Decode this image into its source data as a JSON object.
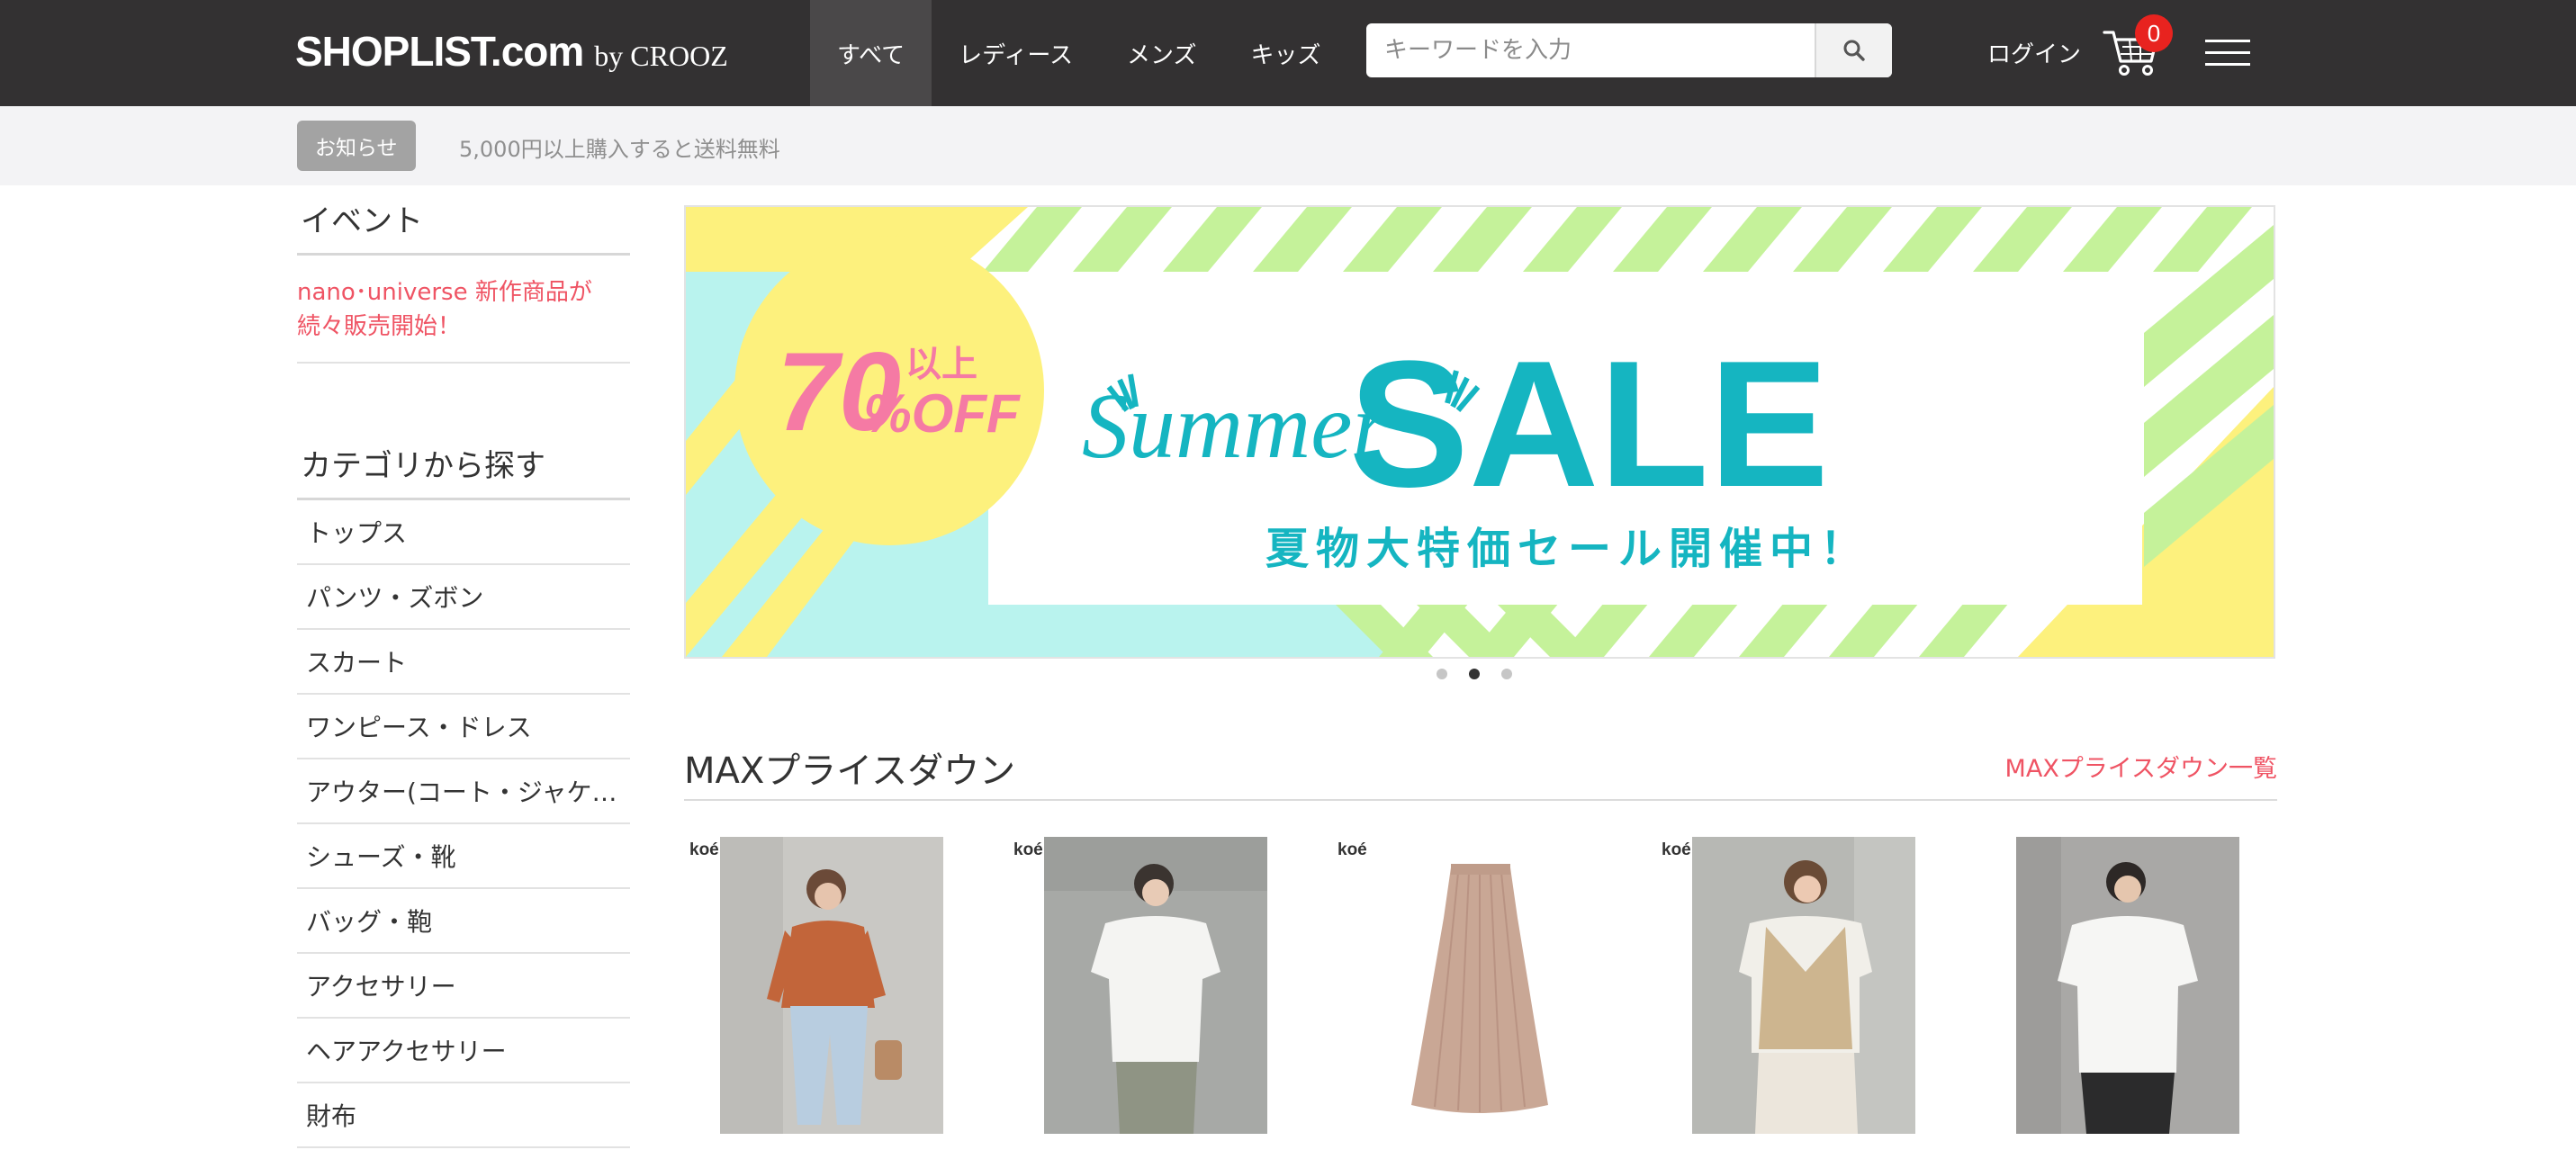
{
  "header": {
    "logo_main": "SHOPLIST.com",
    "logo_by": "by CROOZ",
    "nav": [
      {
        "label": "すべて",
        "active": true
      },
      {
        "label": "レディース",
        "active": false
      },
      {
        "label": "メンズ",
        "active": false
      },
      {
        "label": "キッズ",
        "active": false
      }
    ],
    "search_placeholder": "キーワードを入力",
    "search_icon": "search-icon",
    "login_label": "ログイン",
    "cart_count": "0",
    "cart_icon": "cart-icon",
    "menu_icon": "hamburger-menu-icon"
  },
  "notice": {
    "badge": "お知らせ",
    "text": "5,000円以上購入すると送料無料"
  },
  "sidebar": {
    "event_heading": "イベント",
    "event_link": "nano･universe 新作商品が続々販売開始！",
    "category_heading": "カテゴリから探す",
    "categories": [
      "トップス",
      "パンツ・ズボン",
      "スカート",
      "ワンピース・ドレス",
      "アウター(コート・ジャケ…",
      "シューズ・靴",
      "バッグ・鞄",
      "アクセサリー",
      "ヘアアクセサリー",
      "財布"
    ]
  },
  "banner": {
    "percent": "70",
    "ijou": "以上",
    "off": "%OFF",
    "summer": "Summer",
    "sale": "SALE",
    "subtitle": "夏物大特価セール開催中！",
    "slide_count": 3,
    "active_slide": 2,
    "colors": {
      "mint": "#b9f3ee",
      "stripe_green": "#c5f29a",
      "yellow": "#fdf17d",
      "teal": "#15b5c1",
      "pink": "#f57aa4"
    }
  },
  "section": {
    "title": "MAXプライスダウン",
    "link": "MAXプライスダウン一覧",
    "products": [
      {
        "brand": "koé",
        "item": "orange-knit"
      },
      {
        "brand": "koé",
        "item": "white-tee-woman"
      },
      {
        "brand": "koé",
        "item": "beige-knit-skirt"
      },
      {
        "brand": "koé",
        "item": "beige-knit-vest"
      },
      {
        "brand": "",
        "item": "white-tee-man"
      }
    ]
  },
  "accent_color": "#ef5464"
}
